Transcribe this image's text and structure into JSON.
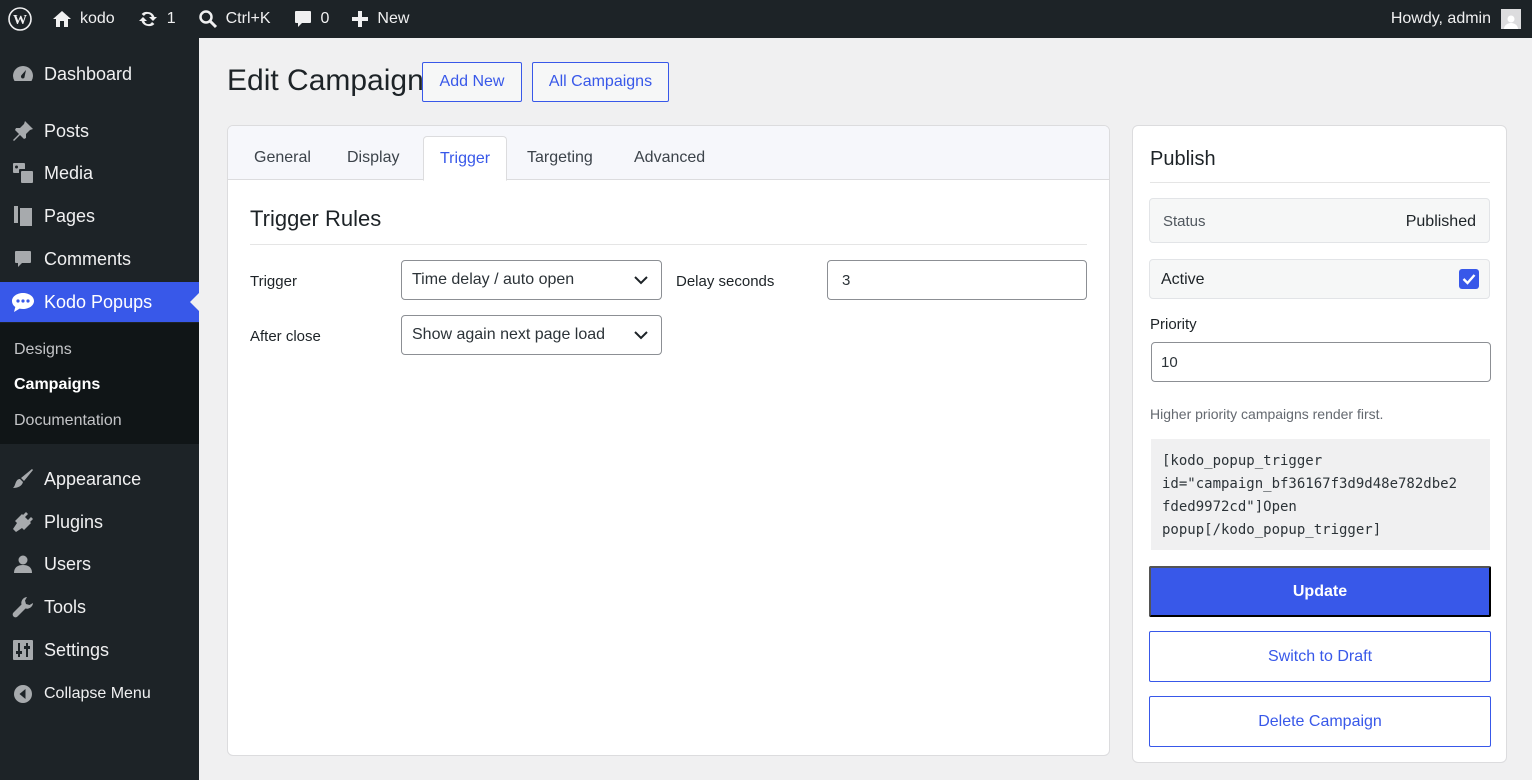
{
  "admin_bar": {
    "site_name": "kodo",
    "updates_count": "1",
    "search_shortcut": "Ctrl+K",
    "comments_count": "0",
    "new_label": "New",
    "greeting": "Howdy, admin"
  },
  "sidebar": {
    "items": [
      {
        "label": "Dashboard",
        "icon": "dashboard-icon"
      },
      {
        "label": "Posts",
        "icon": "pin-icon"
      },
      {
        "label": "Media",
        "icon": "media-icon"
      },
      {
        "label": "Pages",
        "icon": "pages-icon"
      },
      {
        "label": "Comments",
        "icon": "comment-icon"
      },
      {
        "label": "Kodo Popups",
        "icon": "chat-bubble-icon",
        "active": true
      },
      {
        "label": "Appearance",
        "icon": "brush-icon"
      },
      {
        "label": "Plugins",
        "icon": "plug-icon"
      },
      {
        "label": "Users",
        "icon": "user-icon"
      },
      {
        "label": "Tools",
        "icon": "wrench-icon"
      },
      {
        "label": "Settings",
        "icon": "sliders-icon"
      },
      {
        "label": "Collapse Menu",
        "icon": "collapse-icon"
      }
    ],
    "submenu": [
      {
        "label": "Designs"
      },
      {
        "label": "Campaigns",
        "current": true
      },
      {
        "label": "Documentation"
      }
    ]
  },
  "header": {
    "title": "Edit Campaign",
    "add_new": "Add New",
    "all_campaigns": "All Campaigns"
  },
  "tabs": [
    "General",
    "Display",
    "Trigger",
    "Targeting",
    "Advanced"
  ],
  "active_tab": "Trigger",
  "trigger_rules": {
    "title": "Trigger Rules",
    "trigger_label": "Trigger",
    "trigger_value": "Time delay / auto open",
    "delay_label": "Delay seconds",
    "delay_value": "3",
    "after_close_label": "After close",
    "after_close_value": "Show again next page load"
  },
  "publish": {
    "title": "Publish",
    "status_label": "Status",
    "status_value": "Published",
    "active_label": "Active",
    "active_checked": true,
    "priority_label": "Priority",
    "priority_value": "10",
    "help_text": "Higher priority campaigns render first.",
    "shortcode": "[kodo_popup_trigger\nid=\"campaign_bf36167f3d9d48e782dbe2\nfded9972cd\"]Open\npopup[/kodo_popup_trigger]",
    "update_label": "Update",
    "switch_draft_label": "Switch to Draft",
    "delete_label": "Delete Campaign"
  },
  "colors": {
    "accent": "#3858e9",
    "admin_bar_bg": "#1d2327",
    "page_bg": "#f0f0f1"
  }
}
